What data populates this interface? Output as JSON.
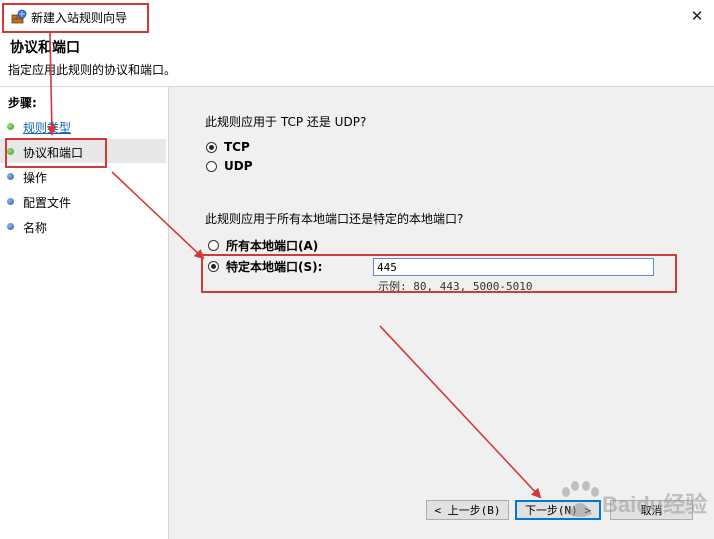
{
  "window": {
    "title": "新建入站规则向导",
    "close_glyph": "✕"
  },
  "header": {
    "title": "协议和端口",
    "subtitle": "指定应用此规则的协议和端口。"
  },
  "sidebar": {
    "label": "步骤:",
    "items": [
      {
        "label": "规则类型",
        "status": "done"
      },
      {
        "label": "协议和端口",
        "status": "current"
      },
      {
        "label": "操作",
        "status": "pending"
      },
      {
        "label": "配置文件",
        "status": "pending"
      },
      {
        "label": "名称",
        "status": "pending"
      }
    ]
  },
  "protocol": {
    "question": "此规则应用于 TCP 还是 UDP?",
    "options": [
      {
        "label": "TCP",
        "selected": true
      },
      {
        "label": "UDP",
        "selected": false
      }
    ]
  },
  "ports": {
    "question": "此规则应用于所有本地端口还是特定的本地端口?",
    "options": [
      {
        "label": "所有本地端口(A)",
        "selected": false
      },
      {
        "label": "特定本地端口(S):",
        "selected": true
      }
    ],
    "value": "445",
    "example": "示例: 80, 443, 5000-5010"
  },
  "buttons": {
    "back": "< 上一步(B)",
    "next": "下一步(N) >",
    "cancel": "取消"
  },
  "watermark": {
    "text": "Baidu经验"
  },
  "colors": {
    "annotation": "#d23a3a",
    "link": "#0b66b2",
    "content_bg": "#f0f0f0"
  }
}
